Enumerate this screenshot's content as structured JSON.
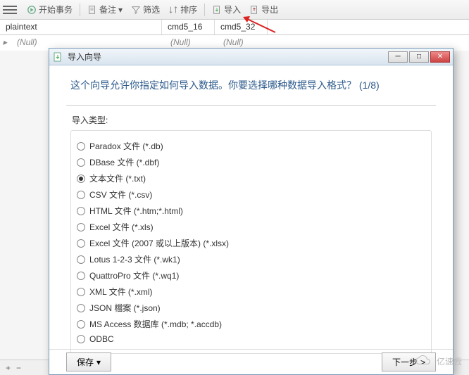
{
  "toolbar": {
    "start_transaction": "开始事务",
    "memo": "备注",
    "filter": "筛选",
    "sort": "排序",
    "import": "导入",
    "export": "导出"
  },
  "columns": {
    "c1": "plaintext",
    "c2": "cmd5_16",
    "c3": "cmd5_32"
  },
  "row": {
    "null1": "(Null)",
    "null2": "(Null)",
    "null3": "(Null)"
  },
  "dialog": {
    "title": "导入向导",
    "header": "这个向导允许你指定如何导入数据。你要选择哪种数据导入格式？ (1/8)",
    "fieldset_label": "导入类型:",
    "options": [
      "Paradox 文件 (*.db)",
      "DBase 文件 (*.dbf)",
      "文本文件 (*.txt)",
      "CSV 文件 (*.csv)",
      "HTML 文件 (*.htm;*.html)",
      "Excel 文件 (*.xls)",
      "Excel 文件 (2007 或以上版本) (*.xlsx)",
      "Lotus 1-2-3 文件 (*.wk1)",
      "QuattroPro 文件 (*.wq1)",
      "XML 文件 (*.xml)",
      "JSON 檔案 (*.json)",
      "MS Access 数据库 (*.mdb; *.accdb)",
      "ODBC"
    ],
    "selected_index": 2,
    "save_btn": "保存",
    "next_btn": "下一步"
  },
  "watermark": "亿速云"
}
